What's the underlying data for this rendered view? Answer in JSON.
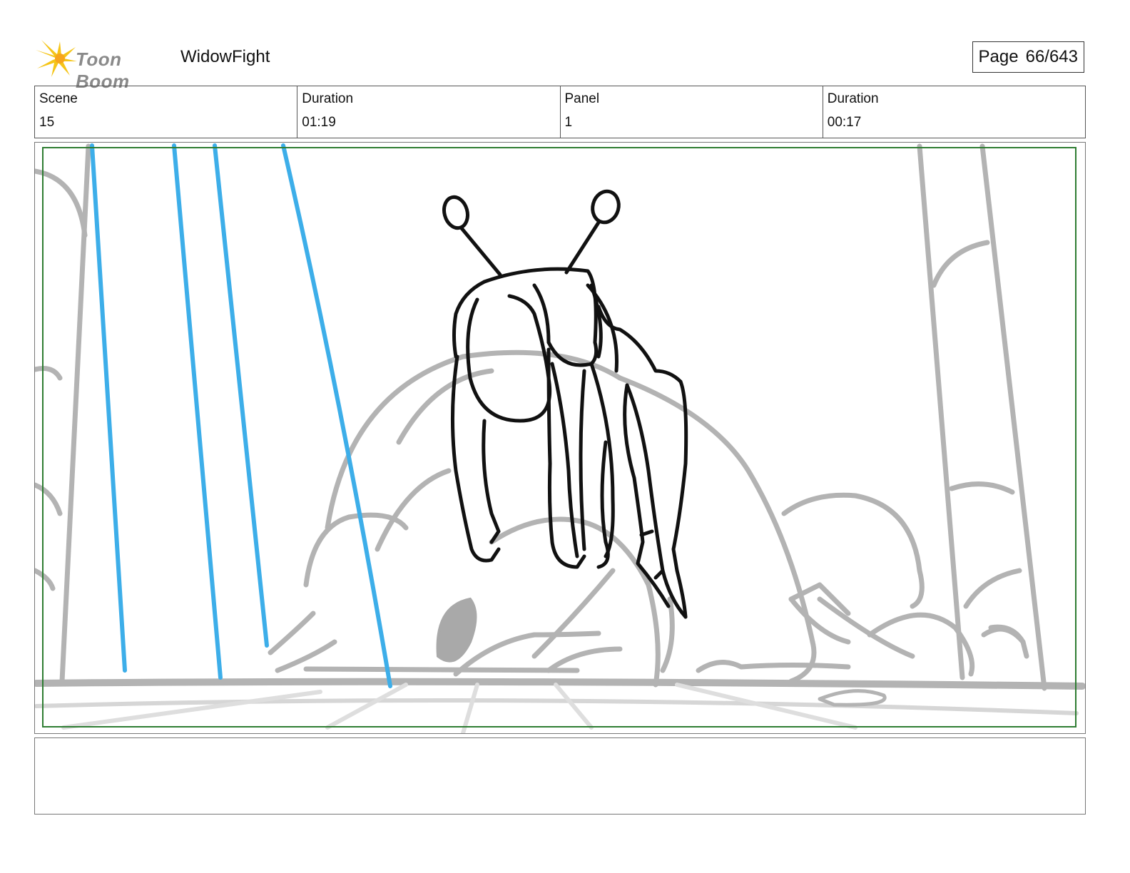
{
  "header": {
    "logo_text": "Toon Boom",
    "project_title": "WidowFight",
    "page_label": "Page",
    "page_value": "66/643"
  },
  "info": {
    "scene_label": "Scene",
    "scene_value": "15",
    "scene_duration_label": "Duration",
    "scene_duration_value": "01:19",
    "panel_label": "Panel",
    "panel_value": "1",
    "panel_duration_label": "Duration",
    "panel_duration_value": "00:17"
  },
  "colors": {
    "safe_frame": "#2e7d32",
    "rain_lines": "#3daee9",
    "background_sketch": "#b3b3b3",
    "character_ink": "#111111",
    "logo_star": "#f5c518"
  },
  "notes": {
    "text": ""
  }
}
